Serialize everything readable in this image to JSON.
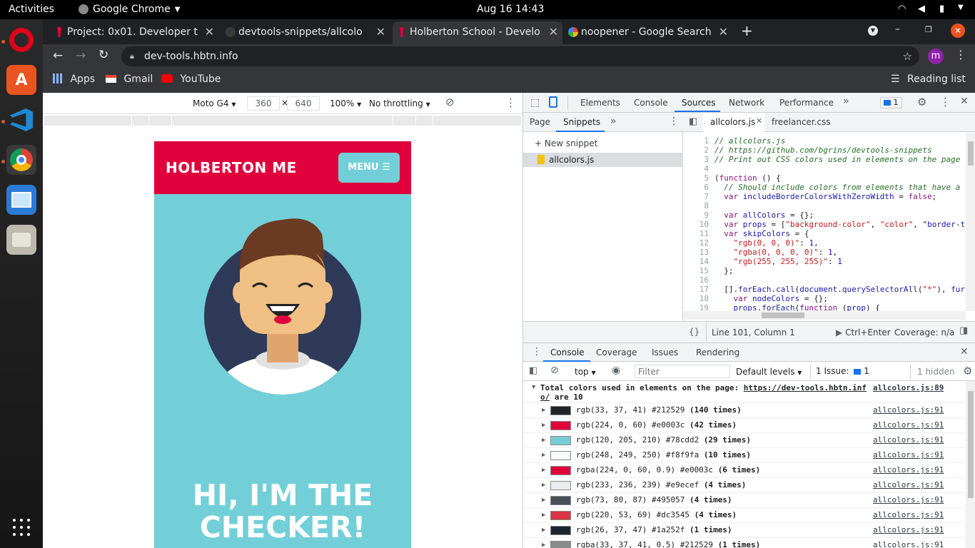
{
  "topbar": {
    "activities": "Activities",
    "app": "Google Chrome",
    "datetime": "Aug 16  14:43"
  },
  "dock": {
    "apps": [
      "opera-icon",
      "software-center-icon",
      "vscode-icon",
      "chrome-icon",
      "screenshot-icon",
      "files-icon"
    ]
  },
  "tabs": [
    {
      "label": "Project: 0x01. Developer t"
    },
    {
      "label": "devtools-snippets/allcolo"
    },
    {
      "label": "Holberton School - Develo"
    },
    {
      "label": "noopener - Google Search"
    }
  ],
  "toolbar": {
    "url": "dev-tools.hbtn.info",
    "avatar": "m"
  },
  "bookmarks": {
    "apps": "Apps",
    "gmail": "Gmail",
    "youtube": "YouTube",
    "reading_list": "Reading list"
  },
  "device": {
    "name": "Moto G4",
    "width": "360",
    "height": "640",
    "times": "×",
    "zoom": "100%",
    "throttle": "No throttling"
  },
  "page": {
    "brand": "HOLBERTON ME",
    "menu": "MENU",
    "headline_1": "HI, I'M THE",
    "headline_2": "CHECKER!"
  },
  "devtools": {
    "tabs": [
      "Elements",
      "Console",
      "Sources",
      "Network",
      "Performance"
    ],
    "issues_count": "1",
    "nav_tabs": [
      "Page",
      "Snippets"
    ],
    "new_snippet": "+ New snippet",
    "snippet_file": "allcolors.js",
    "editor_tabs": [
      "allcolors.js",
      "freelancer.css"
    ],
    "code": [
      {
        "n": "1",
        "t": "// allcolors.js"
      },
      {
        "n": "2",
        "t": "// https://github.com/bgrins/devtools-snippets"
      },
      {
        "n": "3",
        "t": "// Print out CSS colors used in elements on the page"
      },
      {
        "n": "4",
        "t": ""
      },
      {
        "n": "5",
        "t": "(function () {"
      },
      {
        "n": "6",
        "t": "  // Should include colors from elements that have a"
      },
      {
        "n": "7",
        "t": "  var includeBorderColorsWithZeroWidth = false;"
      },
      {
        "n": "8",
        "t": ""
      },
      {
        "n": "9",
        "t": "  var allColors = {};"
      },
      {
        "n": "10",
        "t": "  var props = [\"background-color\", \"color\", \"border-t"
      },
      {
        "n": "11",
        "t": "  var skipColors = {"
      },
      {
        "n": "12",
        "t": "    \"rgb(0, 0, 0)\": 1,"
      },
      {
        "n": "13",
        "t": "    \"rgba(0, 0, 0, 0)\": 1,"
      },
      {
        "n": "14",
        "t": "    \"rgb(255, 255, 255)\": 1"
      },
      {
        "n": "15",
        "t": "  };"
      },
      {
        "n": "16",
        "t": ""
      },
      {
        "n": "17",
        "t": "  [].forEach.call(document.querySelectorAll(\"*\"), fur"
      },
      {
        "n": "18",
        "t": "    var nodeColors = {};"
      },
      {
        "n": "19",
        "t": "    props.forEach(function (prop) {"
      },
      {
        "n": "20",
        "t": ""
      }
    ],
    "status_position": "Line 101, Column 1",
    "run_hint": "Ctrl+Enter",
    "coverage": "Coverage: n/a",
    "drawer_tabs": [
      "Console",
      "Coverage",
      "Issues",
      "Rendering"
    ],
    "context": "top",
    "filter_placeholder": "Filter",
    "levels": "Default levels",
    "issue_label": "1 Issue:",
    "issue_num": "1",
    "hidden": "1 hidden",
    "summary_1": "Total colors used in elements on the page: ",
    "summary_link_1": "https://dev-tools.hbtn.inf",
    "summary_link_2": "o/",
    "summary_2": " are 10",
    "summary_src": "allcolors.js:89",
    "colors": [
      {
        "swatch": "#212529",
        "label": "rgb(33, 37, 41) #212529 ",
        "count": "(140 times)",
        "src": "allcolors.js:91"
      },
      {
        "swatch": "#e0003c",
        "label": "rgb(224, 0, 60) #e0003c ",
        "count": "(42 times)",
        "src": "allcolors.js:91"
      },
      {
        "swatch": "#78cdd2",
        "label": "rgb(120, 205, 210) #78cdd2 ",
        "count": "(29 times)",
        "src": "allcolors.js:91"
      },
      {
        "swatch": "#f8f9fa",
        "label": "rgb(248, 249, 250) #f8f9fa ",
        "count": "(10 times)",
        "src": "allcolors.js:91"
      },
      {
        "swatch": "#e0003c",
        "label": "rgba(224, 0, 60, 0.9) #e0003c ",
        "count": "(6 times)",
        "src": "allcolors.js:91"
      },
      {
        "swatch": "#e9ecef",
        "label": "rgb(233, 236, 239) #e9ecef ",
        "count": "(4 times)",
        "src": "allcolors.js:91"
      },
      {
        "swatch": "#495057",
        "label": "rgb(73, 80, 87) #495057 ",
        "count": "(4 times)",
        "src": "allcolors.js:91"
      },
      {
        "swatch": "#dc3545",
        "label": "rgb(220, 53, 69) #dc3545 ",
        "count": "(4 times)",
        "src": "allcolors.js:91"
      },
      {
        "swatch": "#1a252f",
        "label": "rgb(26, 37, 47) #1a252f ",
        "count": "(1 times)",
        "src": "allcolors.js:91"
      },
      {
        "swatch": "#8a8c8e",
        "label": "rgba(33, 37, 41, 0.5) #212529 ",
        "count": "(1 times)",
        "src": "allcolors.js:91"
      }
    ]
  }
}
